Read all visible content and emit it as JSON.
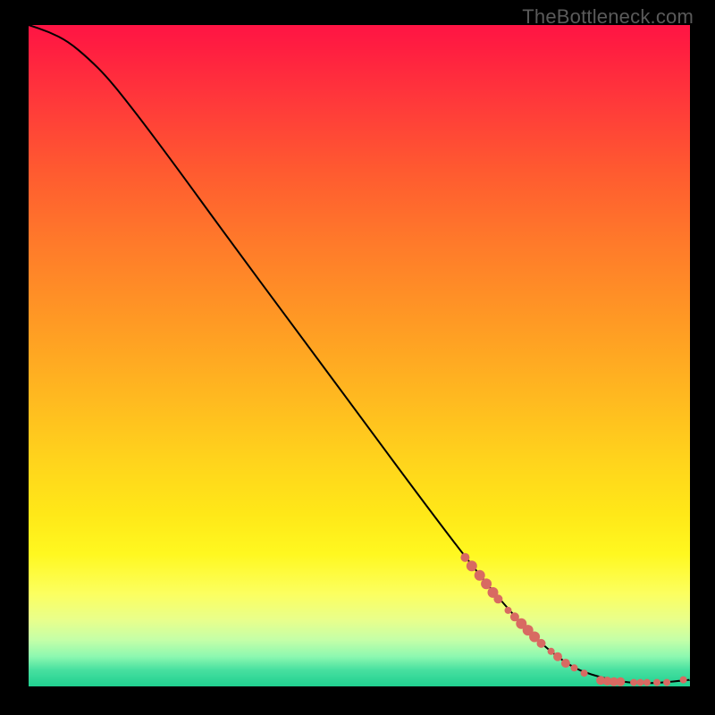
{
  "watermark": "TheBottleneck.com",
  "colors": {
    "dot": "#d86a62",
    "curve": "#000000"
  },
  "chart_data": {
    "type": "line",
    "title": "",
    "xlabel": "",
    "ylabel": "",
    "xlim": [
      0,
      100
    ],
    "ylim": [
      0,
      100
    ],
    "grid": false,
    "axes_visible": false,
    "note": "No axes, ticks, or labels are rendered in the image. X and Y are expressed as 0–100 percent of the plot area (x: left→right, y: bottom→top). The background heat gradient runs top (red ≈ high bottleneck) to bottom (green ≈ low bottleneck).",
    "series": [
      {
        "name": "bottleneck-curve",
        "kind": "line",
        "x": [
          0,
          3,
          6,
          9,
          12,
          16,
          22,
          30,
          40,
          50,
          60,
          68,
          74,
          78,
          82,
          85,
          88,
          90,
          92,
          95,
          100
        ],
        "y": [
          100,
          99,
          97.5,
          95,
          92,
          87,
          79,
          68,
          54.5,
          41,
          27.5,
          17,
          10,
          6,
          3,
          1.8,
          1.0,
          0.7,
          0.5,
          0.5,
          1.0
        ]
      },
      {
        "name": "sample-points",
        "kind": "scatter",
        "points": [
          {
            "x": 66.0,
            "y": 19.5,
            "r": 5
          },
          {
            "x": 67.0,
            "y": 18.2,
            "r": 6
          },
          {
            "x": 68.2,
            "y": 16.8,
            "r": 6
          },
          {
            "x": 69.2,
            "y": 15.5,
            "r": 6
          },
          {
            "x": 70.2,
            "y": 14.2,
            "r": 6
          },
          {
            "x": 71.0,
            "y": 13.2,
            "r": 5
          },
          {
            "x": 72.5,
            "y": 11.5,
            "r": 4
          },
          {
            "x": 73.5,
            "y": 10.5,
            "r": 5
          },
          {
            "x": 74.5,
            "y": 9.5,
            "r": 6
          },
          {
            "x": 75.5,
            "y": 8.5,
            "r": 6
          },
          {
            "x": 76.5,
            "y": 7.5,
            "r": 6
          },
          {
            "x": 77.5,
            "y": 6.5,
            "r": 5
          },
          {
            "x": 79.0,
            "y": 5.3,
            "r": 4
          },
          {
            "x": 80.0,
            "y": 4.5,
            "r": 5
          },
          {
            "x": 81.2,
            "y": 3.5,
            "r": 5
          },
          {
            "x": 82.5,
            "y": 2.8,
            "r": 4
          },
          {
            "x": 84.0,
            "y": 2.0,
            "r": 4
          },
          {
            "x": 86.5,
            "y": 0.9,
            "r": 5
          },
          {
            "x": 87.5,
            "y": 0.8,
            "r": 5
          },
          {
            "x": 88.5,
            "y": 0.7,
            "r": 5
          },
          {
            "x": 89.5,
            "y": 0.7,
            "r": 5
          },
          {
            "x": 91.5,
            "y": 0.6,
            "r": 4
          },
          {
            "x": 92.5,
            "y": 0.6,
            "r": 4
          },
          {
            "x": 93.5,
            "y": 0.6,
            "r": 4
          },
          {
            "x": 95.0,
            "y": 0.6,
            "r": 4
          },
          {
            "x": 96.5,
            "y": 0.6,
            "r": 4
          },
          {
            "x": 99.0,
            "y": 1.0,
            "r": 4
          }
        ]
      }
    ]
  }
}
